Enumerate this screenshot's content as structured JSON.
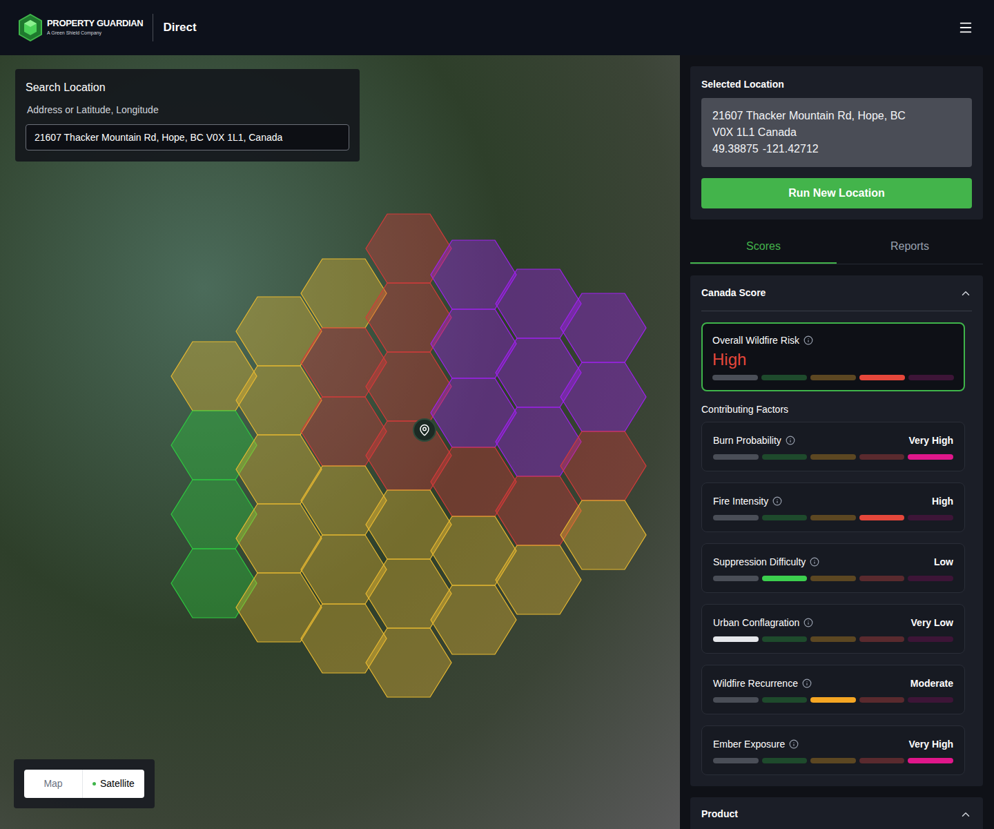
{
  "header": {
    "brand": "PROPERTY GUARDIAN",
    "tagline": "A Green Shield Company",
    "product": "Direct"
  },
  "search": {
    "title": "Search Location",
    "label": "Address or Latitude, Longitude",
    "value": "21607 Thacker Mountain Rd, Hope, BC V0X 1L1, Canada"
  },
  "map": {
    "view_toggle": [
      {
        "label": "Map",
        "selected": false
      },
      {
        "label": "Satellite",
        "selected": true
      }
    ],
    "hex_columns": [
      {
        "cells": [
          {
            "color": "#e8b931"
          },
          {
            "color": "#2ecc40"
          },
          {
            "color": "#2ecc40"
          },
          {
            "color": "#2ecc40"
          }
        ]
      },
      {
        "cells": [
          {
            "color": "#e8b931"
          },
          {
            "color": "#e8b931"
          },
          {
            "color": "#e8b931"
          },
          {
            "color": "#e8b931"
          },
          {
            "color": "#e8b931"
          }
        ]
      },
      {
        "cells": [
          {
            "color": "#e8b931"
          },
          {
            "color": "#d63a3a"
          },
          {
            "color": "#d63a3a"
          },
          {
            "color": "#e8b931"
          },
          {
            "color": "#e8b931"
          },
          {
            "color": "#e8b931"
          }
        ]
      },
      {
        "cells": [
          {
            "color": "#d63a3a"
          },
          {
            "color": "#d63a3a"
          },
          {
            "color": "#d63a3a"
          },
          {
            "color": "#d63a3a"
          },
          {
            "color": "#e8b931"
          },
          {
            "color": "#e8b931"
          },
          {
            "color": "#e8b931"
          }
        ]
      },
      {
        "cells": [
          {
            "color": "#a020f0"
          },
          {
            "color": "#a020f0"
          },
          {
            "color": "#a020f0"
          },
          {
            "color": "#d63a3a"
          },
          {
            "color": "#e8b931"
          },
          {
            "color": "#e8b931"
          }
        ]
      },
      {
        "cells": [
          {
            "color": "#a020f0"
          },
          {
            "color": "#a020f0"
          },
          {
            "color": "#a020f0"
          },
          {
            "color": "#d63a3a"
          },
          {
            "color": "#e8b931"
          }
        ]
      },
      {
        "cells": [
          {
            "color": "#a020f0"
          },
          {
            "color": "#a020f0"
          },
          {
            "color": "#d63a3a"
          },
          {
            "color": "#e8b931"
          }
        ]
      }
    ]
  },
  "selected_location": {
    "title": "Selected Location",
    "address_lines": [
      "21607 Thacker Mountain Rd, Hope, BC",
      "V0X 1L1 Canada"
    ],
    "coordinates": [
      "49.38875",
      "-121.42712"
    ],
    "button": "Run New Location"
  },
  "tabs": [
    {
      "label": "Scores",
      "selected": true
    },
    {
      "label": "Reports",
      "selected": false
    }
  ],
  "canada_score": {
    "title": "Canada Score",
    "expanded": true,
    "overall": {
      "label": "Overall Wildfire Risk",
      "value": "High",
      "level": 0.8,
      "color": "#e5473b"
    },
    "factors_title": "Contributing Factors",
    "factors": [
      {
        "label": "Burn Probability",
        "value": "Very High",
        "level": 1.0,
        "color": "#e0178b"
      },
      {
        "label": "Fire Intensity",
        "value": "High",
        "level": 0.8,
        "color": "#e5473b"
      },
      {
        "label": "Suppression Difficulty",
        "value": "Low",
        "level": 0.4,
        "color": "#3ccf4e"
      },
      {
        "label": "Urban Conflagration",
        "value": "Very Low",
        "level": 0.2,
        "color": "#e5e7eb"
      },
      {
        "label": "Wildfire Recurrence",
        "value": "Moderate",
        "level": 0.6,
        "color": "#f5a623"
      },
      {
        "label": "Ember Exposure",
        "value": "Very High",
        "level": 1.0,
        "color": "#e0178b"
      }
    ]
  },
  "product": {
    "title": "Product",
    "expanded": true
  }
}
